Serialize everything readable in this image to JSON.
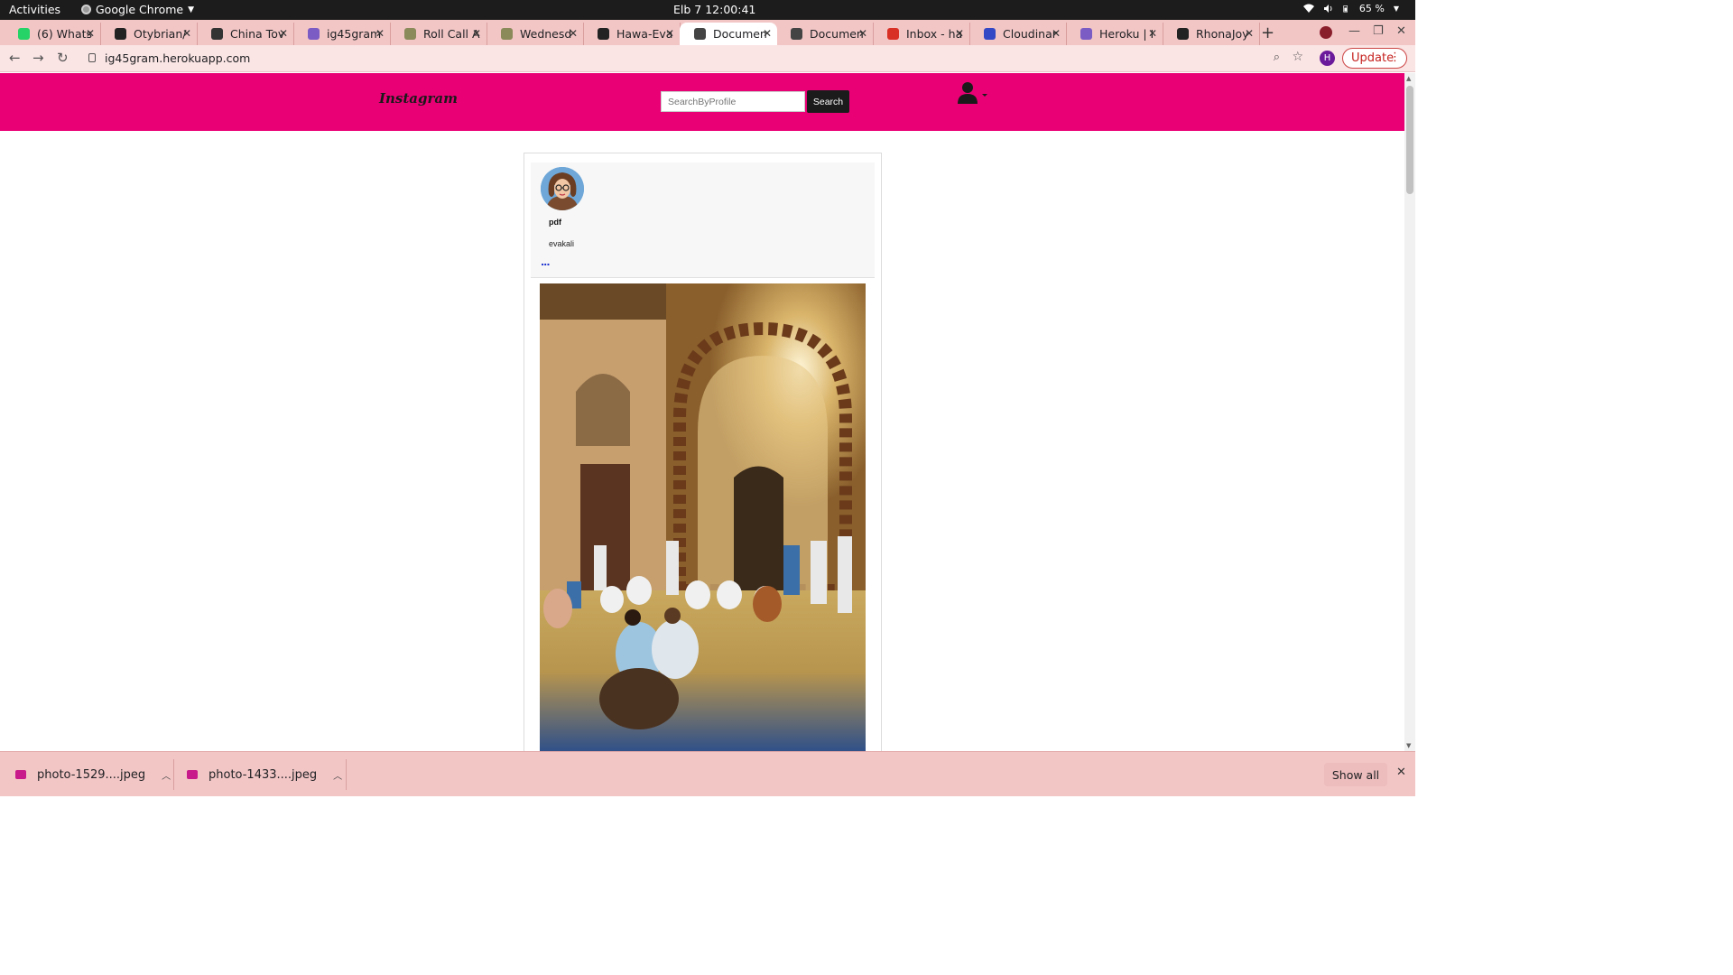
{
  "os_bar": {
    "activities": "Activities",
    "app_name": "Google Chrome",
    "clock": "Elb 7  12:00:41",
    "battery": "65 %"
  },
  "tabs": [
    {
      "title": "(6) Whats",
      "favicon": "whatsapp-icon",
      "color": "#25d366"
    },
    {
      "title": "Otybrian/",
      "favicon": "github-icon",
      "color": "#222222"
    },
    {
      "title": "China Tov",
      "favicon": "site-icon",
      "color": "#333333"
    },
    {
      "title": "ig45gram",
      "favicon": "heroku-icon",
      "color": "#7b5cc4"
    },
    {
      "title": "Roll Call A",
      "favicon": "tree-icon",
      "color": "#8a8a5a"
    },
    {
      "title": "Wednesd",
      "favicon": "tree-icon",
      "color": "#8a8a5a"
    },
    {
      "title": "Hawa-Eva",
      "favicon": "github-icon",
      "color": "#222222"
    },
    {
      "title": "Documen",
      "favicon": "globe-icon",
      "color": "#444444",
      "active": true
    },
    {
      "title": "Documen",
      "favicon": "globe-icon",
      "color": "#444444"
    },
    {
      "title": "Inbox - ha",
      "favicon": "gmail-icon",
      "color": "#d93025"
    },
    {
      "title": "Cloudinar",
      "favicon": "cloud-icon",
      "color": "#3448c5"
    },
    {
      "title": "Heroku | I",
      "favicon": "heroku-icon",
      "color": "#7b5cc4"
    },
    {
      "title": "RhonaJoy",
      "favicon": "github-icon",
      "color": "#222222"
    }
  ],
  "toolbar": {
    "url": "ig45gram.herokuapp.com",
    "profile_initial": "H",
    "update_label": "Update"
  },
  "page": {
    "brand": "Instagram",
    "search_placeholder": "SearchByProfile",
    "search_button": "Search",
    "post": {
      "username": "pdf",
      "caption": "evakali",
      "more": "..."
    }
  },
  "downloads": {
    "items": [
      {
        "name": "photo-1529....jpeg"
      },
      {
        "name": "photo-1433....jpeg"
      }
    ],
    "show_all": "Show all"
  },
  "colors": {
    "navbar": "#ea0075",
    "chrome_frame": "#f3c6c6"
  }
}
